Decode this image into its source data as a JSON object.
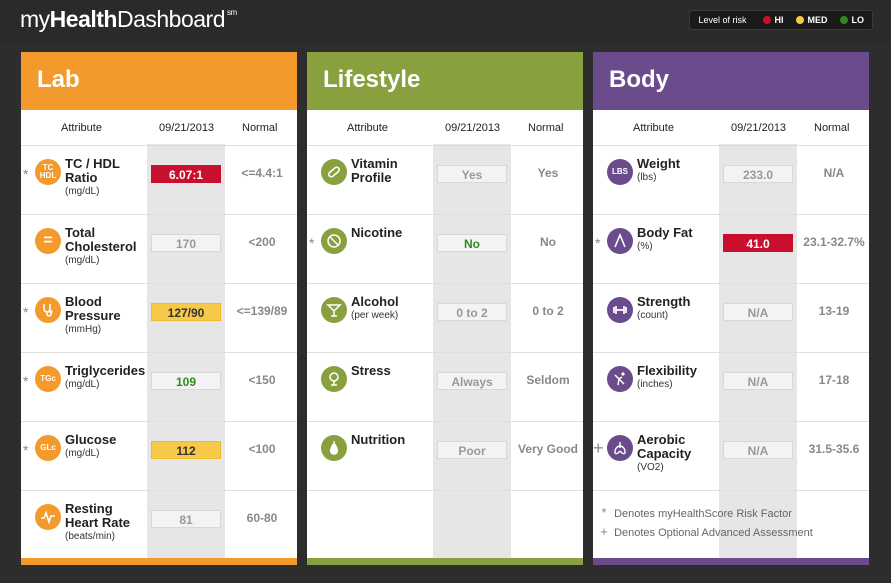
{
  "brand": {
    "pre": "my",
    "bold": "Health",
    "post": "Dashboard",
    "sup": "sm"
  },
  "legend": {
    "label": "Level of risk",
    "hi": "HI",
    "med": "MED",
    "lo": "LO",
    "hi_color": "#c8102e",
    "med_color": "#f7c948",
    "lo_color": "#2e8b1e"
  },
  "columns": {
    "attribute": "Attribute",
    "date": "09/21/2013",
    "normal": "Normal"
  },
  "lab": {
    "title": "Lab",
    "rows": [
      {
        "icon": "TC HDL",
        "name": "TC / HDL Ratio",
        "unit": "(mg/dL)",
        "value": "6.07:1",
        "normal": "<=4.4:1",
        "marker": "*"
      },
      {
        "icon": "=",
        "name": "Total Cholesterol",
        "unit": "(mg/dL)",
        "value": "170",
        "normal": "<200",
        "marker": ""
      },
      {
        "icon": "stethoscope",
        "name": "Blood Pressure",
        "unit": "(mmHg)",
        "value": "127/90",
        "normal": "<=139/89",
        "marker": "*"
      },
      {
        "icon": "TGc",
        "name": "Triglycerides",
        "unit": "(mg/dL)",
        "value": "109",
        "normal": "<150",
        "marker": "*"
      },
      {
        "icon": "GLc",
        "name": "Glucose",
        "unit": "(mg/dL)",
        "value": "112",
        "normal": "<100",
        "marker": "*"
      },
      {
        "icon": "heartbeat",
        "name": "Resting Heart Rate",
        "unit": "(beats/min)",
        "value": "81",
        "normal": "60-80",
        "marker": ""
      }
    ]
  },
  "lifestyle": {
    "title": "Lifestyle",
    "rows": [
      {
        "icon": "pill",
        "name": "Vitamin Profile",
        "unit": "",
        "value": "Yes",
        "normal": "Yes",
        "marker": ""
      },
      {
        "icon": "no-smoking",
        "name": "Nicotine",
        "unit": "",
        "value": "No",
        "normal": "No",
        "marker": "*"
      },
      {
        "icon": "cocktail",
        "name": "Alcohol",
        "unit": "(per week)",
        "value": "0 to 2",
        "normal": "0 to 2",
        "marker": ""
      },
      {
        "icon": "stress",
        "name": "Stress",
        "unit": "",
        "value": "Always",
        "normal": "Seldom",
        "marker": ""
      },
      {
        "icon": "pear",
        "name": "Nutrition",
        "unit": "",
        "value": "Poor",
        "normal": "Very Good",
        "marker": ""
      }
    ]
  },
  "body": {
    "title": "Body",
    "rows": [
      {
        "icon": "LBS",
        "name": "Weight",
        "unit": "(lbs)",
        "value": "233.0",
        "normal": "N/A",
        "marker": ""
      },
      {
        "icon": "body-fat",
        "name": "Body Fat",
        "unit": "(%)",
        "value": "41.0",
        "normal": "23.1-32.7%",
        "marker": "*"
      },
      {
        "icon": "dumbbell",
        "name": "Strength",
        "unit": "(count)",
        "value": "N/A",
        "normal": "13-19",
        "marker": ""
      },
      {
        "icon": "flexibility",
        "name": "Flexibility",
        "unit": "(inches)",
        "value": "N/A",
        "normal": "17-18",
        "marker": ""
      },
      {
        "icon": "lungs",
        "name": "Aerobic Capacity",
        "unit": "(VO2)",
        "value": "N/A",
        "normal": "31.5-35.6",
        "marker": "+"
      }
    ],
    "notes": [
      {
        "sym": "*",
        "text": "Denotes myHealthScore Risk Factor"
      },
      {
        "sym": "+",
        "text": "Denotes Optional Advanced Assessment"
      }
    ]
  }
}
